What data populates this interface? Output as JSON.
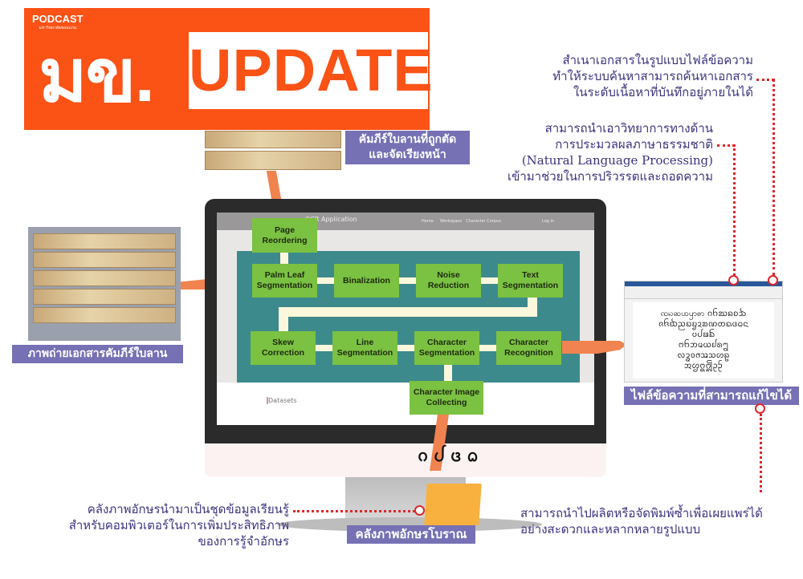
{
  "logo": {
    "podcast": "PODCAST",
    "podcast_sub": "มหาวิทยาลัยขอนแก่น",
    "title_thai": "มข.",
    "title_en": "UPDATE",
    "brand_color": "#fb5216"
  },
  "labels": {
    "reordered_leaves": [
      "คัมภีร์ใบลานที่ถูกตัด",
      "และจัดเรียงหน้า"
    ],
    "photo": "ภาพถ่ายเอกสารคัมภีร์ใบลาน",
    "editable_file": "ไฟล์ข้อความที่สามารถแก้ไขได้",
    "corpus": "คลังภาพอักษรโบราณ"
  },
  "screen": {
    "app_title": "OCR Application",
    "nav": [
      "Home",
      "Workspace",
      "Character Corpus",
      "Log in"
    ],
    "section": "Datasets"
  },
  "pipeline": {
    "page_reordering": "Page Reordering",
    "row1": [
      "Palm Leaf Segmentation",
      "Binalization",
      "Noise Reduction",
      "Text Segmentation"
    ],
    "row2": [
      "Skew Correction",
      "Line Segmentation",
      "Character Segmentation",
      "Character Recognition"
    ],
    "collecting": "Character Image Collecting",
    "box_color": "#7bc142",
    "panel_color": "#3d8a8c"
  },
  "descriptions": {
    "search": [
      "สำเนาเอกสารในรูปแบบไฟล์ข้อความ",
      "ทำให้ระบบค้นหาสามารถค้นหาเอกสาร",
      "ในระดับเนื้อหาที่บันทึกอยู่ภายในได้"
    ],
    "nlp": [
      "สามารถนำเอาวิทยาการทางด้าน",
      "การประมวลผลภาษาธรรมชาติ",
      "(Natural Language Processing)",
      "เข้ามาช่วยในการปริวรรตและถอดความ"
    ],
    "dataset": [
      "คลังภาพอักษรนำมาเป็นชุดข้อมูลเรียนรู้",
      "สำหรับคอมพิวเตอร์ในการเพิ่มประสิทธิภาพ",
      "ของการรู้จำอักษร"
    ],
    "publish": [
      "สามารถนำไปผลิตหรือจัดพิมพ์ซ้ำเพื่อเผยแพร่ได้",
      "อย่างสะดวกและหลากหลายรูปแบบ"
    ]
  },
  "document_text": [
    "ꩡꩢꩣꩤꩥꩦ ᨣᨤᨥᨦᨧᨨ",
    "ᨩᨪᨫᨬᨭᨮᨯᨰᨱᨲᨳᨴᨵᨶ",
    "ᨷᨸᨹᨺ",
    "ᨻᨼᨽᨾᨿᩀᩁᩂ",
    "ᩃᩄᩅᩆᩇᩈᩉᩊ",
    "ᩋᩌᩍᩎᩏᩐ"
  ],
  "falling_glyphs": "ᨣ ᨸ ᨴ ᨵ"
}
